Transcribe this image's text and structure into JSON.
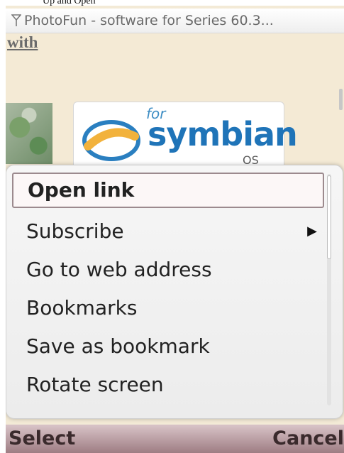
{
  "caption": "Up and Open",
  "titlebar": {
    "title": "PhotoFun - software for Series 60.3...",
    "signal_icon": "antenna-signal-icon"
  },
  "page": {
    "link_text": "with",
    "logo": {
      "for": "for",
      "name": "symbian",
      "os": "OS"
    }
  },
  "menu": {
    "items": [
      {
        "label": "Open link",
        "selected": true
      },
      {
        "label": "Subscribe",
        "has_submenu": true
      },
      {
        "label": "Go to web address"
      },
      {
        "label": "Bookmarks"
      },
      {
        "label": "Save as bookmark"
      },
      {
        "label": "Rotate screen"
      }
    ],
    "submenu_icon": "triangle-right-icon"
  },
  "softkeys": {
    "left": "Select",
    "right": "Cancel"
  },
  "colors": {
    "accent": "#1f74b8",
    "selection_border": "#9c8a8e",
    "softkey_bg": "#b8999e"
  }
}
